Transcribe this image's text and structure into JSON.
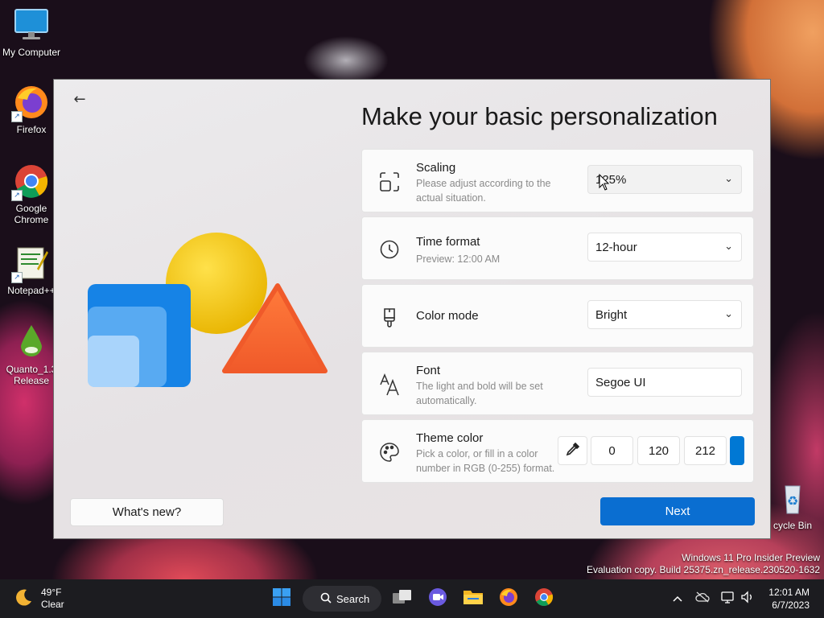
{
  "desktop": {
    "icons": [
      {
        "label": "My Computer",
        "icon": "monitor-icon"
      },
      {
        "label": "Firefox",
        "icon": "firefox-icon"
      },
      {
        "label": "Google Chrome",
        "icon": "chrome-icon"
      },
      {
        "label": "Notepad++",
        "icon": "notepad-plus-plus-icon"
      },
      {
        "label": "Quanto_1.3 Release",
        "icon": "quanto-drop-icon"
      },
      {
        "label": "cycle Bin",
        "icon": "recycle-bin-icon"
      }
    ],
    "watermark": {
      "line1": "Windows 11 Pro Insider Preview",
      "line2": "Evaluation copy. Build 25375.zn_release.230520-1632"
    }
  },
  "window": {
    "title": "Make your basic personalization",
    "settings": {
      "scaling": {
        "title": "Scaling",
        "desc": "Please adjust according to the actual situation.",
        "value": "125%"
      },
      "time_format": {
        "title": "Time format",
        "desc": "Preview: 12:00 AM",
        "value": "12-hour"
      },
      "color_mode": {
        "title": "Color mode",
        "value": "Bright"
      },
      "font": {
        "title": "Font",
        "desc": "The light and bold will be set automatically.",
        "value": "Segoe UI"
      },
      "theme_color": {
        "title": "Theme color",
        "desc": "Pick a color, or fill in a color number in RGB (0-255) format.",
        "r": "0",
        "g": "120",
        "b": "212",
        "swatch": "#0078d4"
      }
    },
    "whats_new_label": "What's new?",
    "next_label": "Next",
    "accent_color": "#0a6ed1"
  },
  "taskbar": {
    "weather": {
      "temp": "49°F",
      "condition": "Clear"
    },
    "search_label": "Search",
    "clock": {
      "time": "12:01 AM",
      "date": "6/7/2023"
    }
  }
}
